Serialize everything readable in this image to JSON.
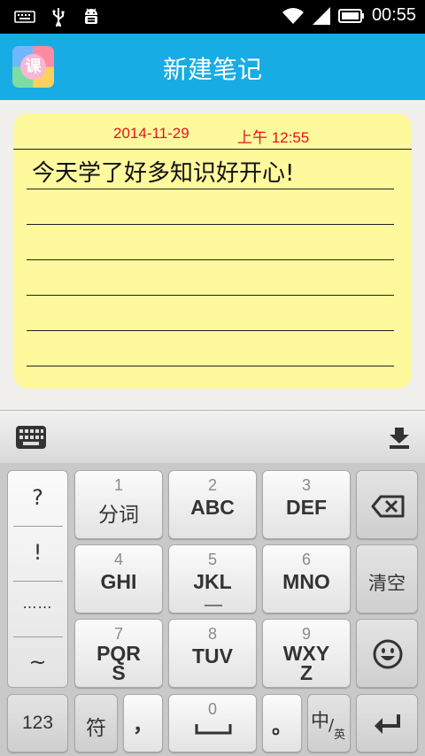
{
  "status_bar": {
    "time": "00:55"
  },
  "app_bar": {
    "title": "新建笔记",
    "icon_glyph": "课"
  },
  "note": {
    "date": "2014-11-29",
    "time": "上午 12:55",
    "text": "今天学了好多知识好开心!"
  },
  "keyboard": {
    "symbols": [
      "?",
      "!",
      "……",
      "~"
    ],
    "keys": {
      "k1": {
        "num": "1",
        "label": "分词"
      },
      "k2": {
        "num": "2",
        "label": "ABC"
      },
      "k3": {
        "num": "3",
        "label": "DEF"
      },
      "k4": {
        "num": "4",
        "label": "GHI"
      },
      "k5": {
        "num": "5",
        "label": "JKL"
      },
      "k6": {
        "num": "6",
        "label": "MNO"
      },
      "k7": {
        "num": "7",
        "label": "PQR\nS"
      },
      "k8": {
        "num": "8",
        "label": "TUV"
      },
      "k9": {
        "num": "9",
        "label": "WXY\nZ"
      },
      "k0": {
        "num": "0"
      }
    },
    "clear_label": "清空",
    "num_label": "123",
    "fu_label": "符",
    "comma_label": "，",
    "period_label": "。",
    "lang_main": "中",
    "lang_sub": "英"
  }
}
